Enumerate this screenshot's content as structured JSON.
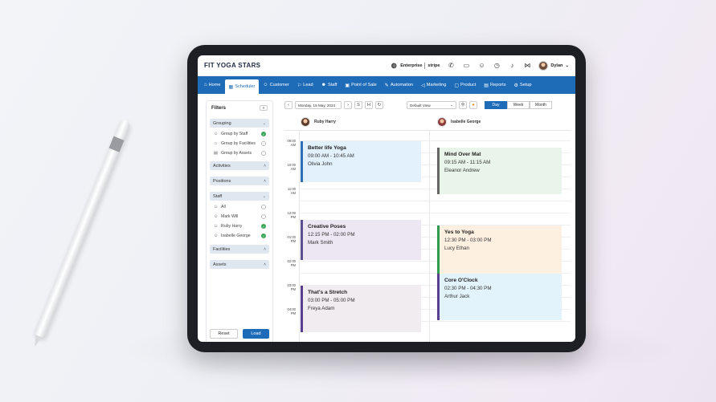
{
  "app": {
    "brand": "FIT YOGA STARS"
  },
  "topbar": {
    "enterprise_label": "Enterprise",
    "stripe_label": "stripe",
    "user_name": "Dylan",
    "icons": [
      "globe-icon",
      "phone-icon",
      "presentation-icon",
      "users-icon",
      "clock-icon",
      "bell-icon",
      "share-icon"
    ]
  },
  "nav": {
    "items": [
      {
        "label": "Home",
        "icon": "home-icon",
        "active": false
      },
      {
        "label": "Scheduler",
        "icon": "calendar-icon",
        "active": true
      },
      {
        "label": "Customer",
        "icon": "user-icon",
        "active": false
      },
      {
        "label": "Lead",
        "icon": "lead-icon",
        "active": false
      },
      {
        "label": "Staff",
        "icon": "staff-icon",
        "active": false
      },
      {
        "label": "Point of Sale",
        "icon": "pos-icon",
        "active": false
      },
      {
        "label": "Automation",
        "icon": "automation-icon",
        "active": false
      },
      {
        "label": "Marketing",
        "icon": "megaphone-icon",
        "active": false
      },
      {
        "label": "Product",
        "icon": "box-icon",
        "active": false
      },
      {
        "label": "Reports",
        "icon": "report-icon",
        "active": false
      },
      {
        "label": "Setup",
        "icon": "gear-icon",
        "active": false
      }
    ]
  },
  "filters": {
    "title": "Filters",
    "collapse": "«",
    "grouping": {
      "label": "Grouping",
      "options": [
        {
          "label": "Group by Staff",
          "checked": true
        },
        {
          "label": "Group by Facilities",
          "checked": false
        },
        {
          "label": "Group by Assets",
          "checked": false
        }
      ]
    },
    "activities_label": "Activities",
    "positions_label": "Positions",
    "staff": {
      "label": "Staff",
      "options": [
        {
          "label": "All",
          "checked": false
        },
        {
          "label": "Mark Will",
          "checked": false
        },
        {
          "label": "Ruby Harry",
          "checked": true
        },
        {
          "label": "Isabelle George",
          "checked": true
        }
      ]
    },
    "facilities_label": "Facilities",
    "assets_label": "Assets",
    "reset_label": "Reset",
    "load_label": "Load"
  },
  "toolbar": {
    "date": "Monday, 15 May, 2024",
    "view": "Default View",
    "s_label": "S",
    "h_label": "H",
    "views": [
      "Day",
      "Week",
      "Month"
    ],
    "active_view": "Day"
  },
  "staff_columns": [
    {
      "name": "Ruby Harry"
    },
    {
      "name": "Isabelle George"
    }
  ],
  "time_labels": [
    [
      "09:00",
      "AM"
    ],
    [
      "10:00",
      "AM"
    ],
    [
      "11:00",
      "AM"
    ],
    [
      "12:00",
      "PM"
    ],
    [
      "01:00",
      "PM"
    ],
    [
      "02:00",
      "PM"
    ],
    [
      "03:00",
      "PM"
    ],
    [
      "04:00",
      "PM"
    ]
  ],
  "events": [
    {
      "title": "Better life Yoga",
      "time": "09:00 AM - 10:45 AM",
      "instructor": "Olivia John",
      "column": 0,
      "bar": "#2f6fb8",
      "bg": "#e2f1fb"
    },
    {
      "title": "Creative Poses",
      "time": "12:15 PM - 02:00 PM",
      "instructor": "Mark Smith",
      "column": 0,
      "bar": "#5a4f8f",
      "bg": "#ede6f3"
    },
    {
      "title": "That's a Stretch",
      "time": "03:00 PM - 05:00 PM",
      "instructor": "Freya Adam",
      "column": 0,
      "bar": "#5a3e8f",
      "bg": "#f1ecef"
    },
    {
      "title": "Mind Over Mat",
      "time": "09:15 AM - 11:15 AM",
      "instructor": "Eleanor Andrew",
      "column": 1,
      "bar": "#666666",
      "bg": "#e9f5ea"
    },
    {
      "title": "Yes to Yoga",
      "time": "12:30 PM - 03:00 PM",
      "instructor": "Lucy Ethan",
      "column": 1,
      "bar": "#2e9b4d",
      "bg": "#fdf0e0"
    },
    {
      "title": "Core O'Clock",
      "time": "02:30 PM - 04:30 PM",
      "instructor": "Arthur Jack",
      "column": 1,
      "bar": "#5a3e8f",
      "bg": "#e3f3fb"
    }
  ]
}
